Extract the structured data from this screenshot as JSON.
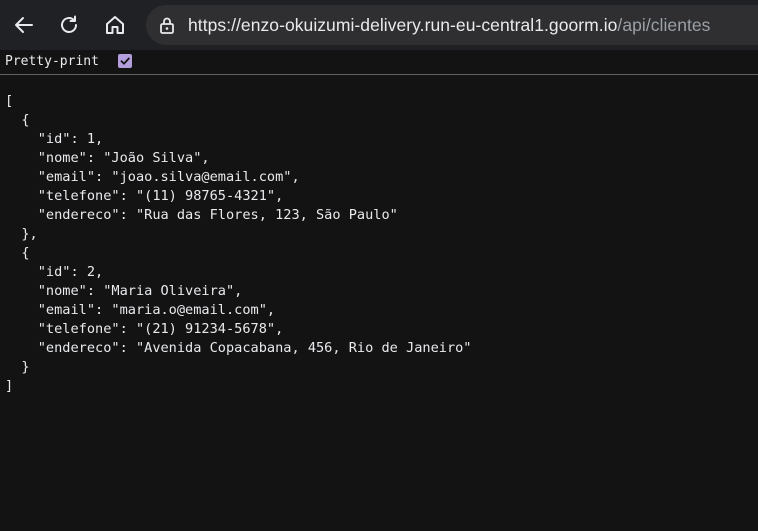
{
  "browser": {
    "url_origin": "https://enzo-okuizumi-delivery.run-eu-central1.goorm.io",
    "url_path": "/api/clientes",
    "icons": {
      "back": "back-arrow-icon",
      "reload": "reload-icon",
      "home": "home-icon",
      "site_info": "site-info-icon"
    }
  },
  "pretty_print": {
    "label": "Pretty-print",
    "checked": true,
    "color": "#b39ddb"
  },
  "json_text": "[\n  {\n    \"id\": 1,\n    \"nome\": \"João Silva\",\n    \"email\": \"joao.silva@email.com\",\n    \"telefone\": \"(11) 98765-4321\",\n    \"endereco\": \"Rua das Flores, 123, São Paulo\"\n  },\n  {\n    \"id\": 2,\n    \"nome\": \"Maria Oliveira\",\n    \"email\": \"maria.o@email.com\",\n    \"telefone\": \"(21) 91234-5678\",\n    \"endereco\": \"Avenida Copacabana, 456, Rio de Janeiro\"\n  }\n]"
}
